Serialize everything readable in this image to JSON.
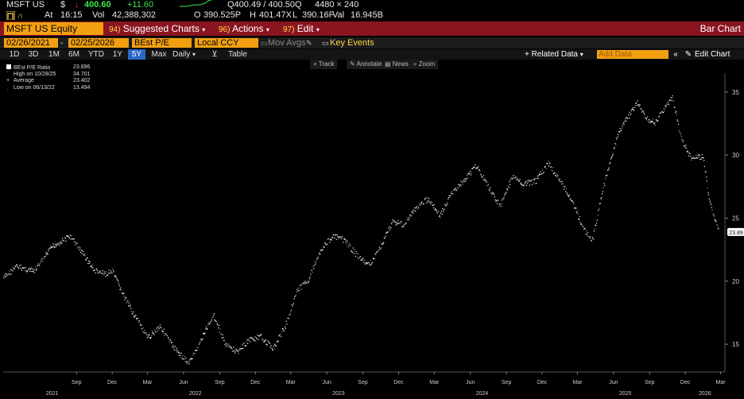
{
  "ticker": {
    "symbol": "MSFT US",
    "currency": "$",
    "last": "400.60",
    "change": "+11.60",
    "bid_ask": "Q400.49 / 400.50Q",
    "size": "4480 × 240",
    "at_label": "At",
    "time": "16:15",
    "vol_label": "Vol",
    "vol": "42,388,302",
    "open_label": "O",
    "open": "390.525P",
    "high_label": "H",
    "high": "401.47X",
    "low_label": "L",
    "low": "390.16F",
    "val_label": "Val",
    "val": "16.945B"
  },
  "toolbar": {
    "security": "MSFT US Equity",
    "suggested_num": "94)",
    "suggested": "Suggested Charts",
    "actions_num": "96)",
    "actions": "Actions",
    "edit_num": "97)",
    "edit": "Edit",
    "view_name": "Bar Chart"
  },
  "settings": {
    "start_date": "02/26/2021",
    "end_date": "02/25/2026",
    "field": "BEst P/E",
    "currency": "Local CCY",
    "mov_avgs": "Mov Avgs",
    "key_events": "Key Events"
  },
  "ranges": {
    "items": [
      "1D",
      "3D",
      "1M",
      "6M",
      "YTD",
      "1Y",
      "5Y",
      "Max"
    ],
    "selected": "5Y",
    "frequency": "Daily",
    "table": "Table",
    "related": "+ Related Data",
    "add_data": "Add Data",
    "edit_chart": "Edit Chart"
  },
  "chart_tools": {
    "track": "Track",
    "annotate": "Annotate",
    "news": "News",
    "zoom": "Zoom"
  },
  "legend": {
    "series_label": "BEst P/E Ratio",
    "series_value": "23.896",
    "high_label": "High on 10/28/25",
    "high_value": "34.701",
    "avg_label": "Average",
    "avg_value": "23.402",
    "low_label": "Low on 06/13/22",
    "low_value": "13.494"
  },
  "colors": {
    "accent_orange": "#f2a010",
    "bar_red": "#8a1520",
    "up_green": "#3ee64a",
    "down_red": "#ff3b3b",
    "select_blue": "#2a68c8"
  },
  "chart_data": {
    "type": "line",
    "series": [
      {
        "name": "BEst P/E Ratio",
        "x": [
          "2021-02-26",
          "2021-04-01",
          "2021-05-15",
          "2021-07-01",
          "2021-08-15",
          "2021-09-15",
          "2021-10-15",
          "2021-11-10",
          "2021-12-01",
          "2022-01-01",
          "2022-02-01",
          "2022-03-01",
          "2022-04-01",
          "2022-05-01",
          "2022-06-13",
          "2022-07-01",
          "2022-08-15",
          "2022-09-15",
          "2022-10-15",
          "2022-11-15",
          "2022-12-15",
          "2023-01-15",
          "2023-02-15",
          "2023-03-15",
          "2023-04-15",
          "2023-05-15",
          "2023-06-15",
          "2023-07-15",
          "2023-08-15",
          "2023-09-15",
          "2023-10-15",
          "2023-11-15",
          "2023-12-15",
          "2024-01-15",
          "2024-02-15",
          "2024-03-15",
          "2024-04-15",
          "2024-05-15",
          "2024-06-15",
          "2024-07-05",
          "2024-08-15",
          "2024-09-15",
          "2024-10-15",
          "2024-11-15",
          "2024-12-15",
          "2025-01-15",
          "2025-02-15",
          "2025-03-15",
          "2025-04-08",
          "2025-05-05",
          "2025-06-15",
          "2025-07-31",
          "2025-08-20",
          "2025-09-15",
          "2025-10-28",
          "2025-11-20",
          "2025-12-15",
          "2026-01-15",
          "2026-01-30",
          "2026-02-25"
        ],
        "y": [
          20.3,
          21.2,
          20.8,
          22.8,
          23.6,
          22.3,
          20.9,
          20.6,
          20.8,
          18.7,
          17.0,
          15.5,
          16.5,
          15.0,
          13.5,
          14.5,
          17.4,
          15.0,
          14.4,
          15.4,
          15.6,
          14.7,
          16.5,
          19.2,
          20.2,
          22.5,
          23.6,
          23.3,
          22.1,
          21.3,
          22.7,
          24.8,
          24.5,
          25.9,
          26.6,
          25.2,
          27.1,
          28.0,
          29.2,
          28.1,
          26.0,
          28.3,
          27.7,
          28.0,
          29.4,
          28.0,
          26.4,
          24.2,
          23.3,
          27.5,
          32.0,
          34.2,
          33.0,
          32.6,
          34.7,
          31.3,
          29.8,
          29.9,
          26.4,
          23.9
        ]
      }
    ],
    "x_tick_labels": [
      "Sep",
      "Dec",
      "Mar",
      "Jun",
      "Sep",
      "Dec",
      "Mar",
      "Jun",
      "Sep",
      "Dec",
      "Mar",
      "Jun",
      "Sep",
      "Dec",
      "Mar",
      "Jun",
      "Sep",
      "Dec",
      "Mar",
      "Jun",
      "Sep",
      "Dec",
      "Mar"
    ],
    "x_tick_dates": [
      "2021-09-01",
      "2021-12-01",
      "2022-03-01",
      "2022-06-01",
      "2022-09-01",
      "2022-12-01",
      "2023-03-01",
      "2023-06-01",
      "2023-09-01",
      "2023-12-01",
      "2024-03-01",
      "2024-06-01",
      "2024-09-01",
      "2024-12-01",
      "2025-03-01",
      "2025-06-01",
      "2025-09-01",
      "2025-12-01",
      "2026-03-01"
    ],
    "year_labels": [
      "2021",
      "2022",
      "2023",
      "2024",
      "2025",
      "2026"
    ],
    "year_dates": [
      "2021-07-01",
      "2022-07-01",
      "2023-07-01",
      "2024-07-01",
      "2025-07-01",
      "2026-01-20"
    ],
    "y_ticks": [
      15,
      20,
      25,
      30,
      35
    ],
    "ylim": [
      12.8,
      36.5
    ],
    "xlim": [
      "2021-02-26",
      "2026-03-12"
    ],
    "last_value_label": "23.89",
    "grid": false
  }
}
